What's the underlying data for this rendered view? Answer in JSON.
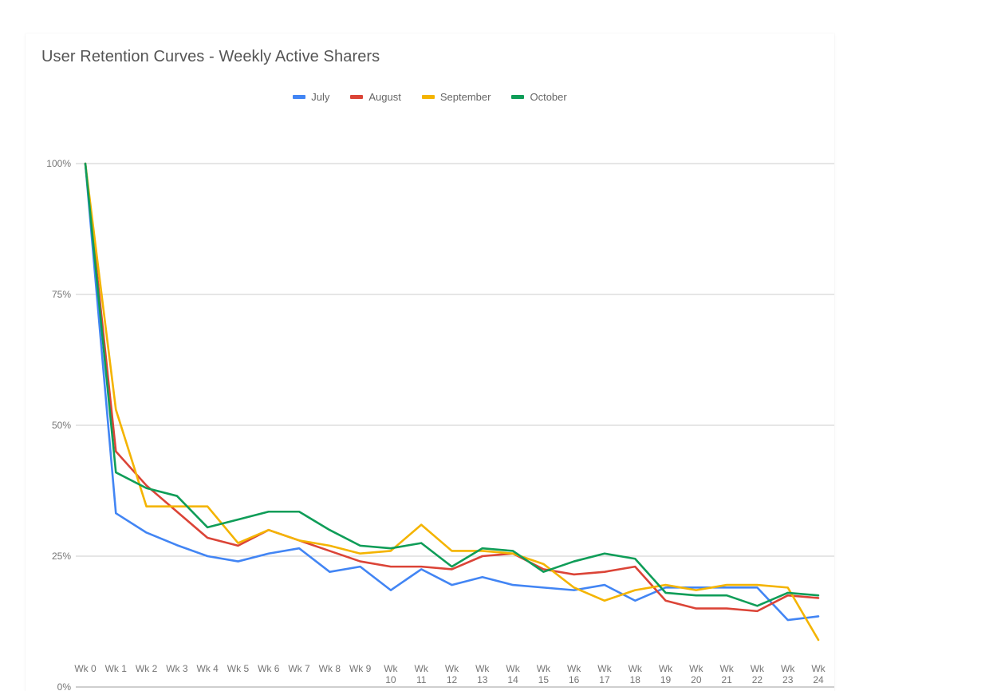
{
  "chart_title": "User Retention Curves - Weekly Active Sharers",
  "legend": {
    "position": "top-center",
    "entries": [
      {
        "label": "July",
        "color": "#4285F4"
      },
      {
        "label": "August",
        "color": "#DB4437"
      },
      {
        "label": "September",
        "color": "#F4B400"
      },
      {
        "label": "October",
        "color": "#0F9D58"
      }
    ]
  },
  "axes": {
    "y_ticks": [
      "0%",
      "25%",
      "50%",
      "75%",
      "100%"
    ],
    "x_ticks": [
      "Wk 0",
      "Wk 1",
      "Wk 2",
      "Wk 3",
      "Wk 4",
      "Wk 5",
      "Wk 6",
      "Wk 7",
      "Wk 8",
      "Wk 9",
      "Wk 10",
      "Wk 11",
      "Wk 12",
      "Wk 13",
      "Wk 14",
      "Wk 15",
      "Wk 16",
      "Wk 17",
      "Wk 18",
      "Wk 19",
      "Wk 20",
      "Wk 21",
      "Wk 22",
      "Wk 23",
      "Wk 24"
    ]
  },
  "chart_data": {
    "type": "line",
    "title": "User Retention Curves - Weekly Active Sharers",
    "xlabel": "",
    "ylabel": "",
    "ylim": [
      0,
      100
    ],
    "yticks": [
      0,
      25,
      50,
      75,
      100
    ],
    "ytick_labels": [
      "0%",
      "25%",
      "50%",
      "75%",
      "100%"
    ],
    "grid": "horizontal",
    "legend_position": "top-center",
    "categories": [
      "Wk 0",
      "Wk 1",
      "Wk 2",
      "Wk 3",
      "Wk 4",
      "Wk 5",
      "Wk 6",
      "Wk 7",
      "Wk 8",
      "Wk 9",
      "Wk 10",
      "Wk 11",
      "Wk 12",
      "Wk 13",
      "Wk 14",
      "Wk 15",
      "Wk 16",
      "Wk 17",
      "Wk 18",
      "Wk 19",
      "Wk 20",
      "Wk 21",
      "Wk 22",
      "Wk 23",
      "Wk 24"
    ],
    "series": [
      {
        "name": "July",
        "color": "#4285F4",
        "values": [
          100,
          33.2,
          29.5,
          27.1,
          25.0,
          24.0,
          25.5,
          26.5,
          22.0,
          23.0,
          18.5,
          22.5,
          19.5,
          21.0,
          19.5,
          19.0,
          18.5,
          19.5,
          16.5,
          19.0,
          19.0,
          19.0,
          19.0,
          12.8,
          13.5
        ]
      },
      {
        "name": "August",
        "color": "#DB4437",
        "values": [
          100,
          45.0,
          38.5,
          33.5,
          28.5,
          27.0,
          30.0,
          28.0,
          26.0,
          24.0,
          23.0,
          23.0,
          22.5,
          25.0,
          25.5,
          22.5,
          21.5,
          22.0,
          23.0,
          16.5,
          15.0,
          15.0,
          14.5,
          17.5,
          17.0
        ]
      },
      {
        "name": "September",
        "color": "#F4B400",
        "values": [
          100,
          53.0,
          34.5,
          34.5,
          34.5,
          27.5,
          30.0,
          28.0,
          27.0,
          25.5,
          26.0,
          31.0,
          26.0,
          26.0,
          25.5,
          23.5,
          19.0,
          16.5,
          18.5,
          19.5,
          18.5,
          19.5,
          19.5,
          19.0,
          9.0
        ]
      },
      {
        "name": "October",
        "color": "#0F9D58",
        "values": [
          100,
          41.0,
          38.0,
          36.5,
          30.5,
          32.0,
          33.5,
          33.5,
          30.0,
          27.0,
          26.5,
          27.5,
          23.0,
          26.5,
          26.0,
          22.0,
          24.0,
          25.5,
          24.5,
          18.0,
          17.5,
          17.5,
          15.5,
          18.0,
          17.5
        ]
      }
    ]
  },
  "plot_geometry": {
    "grid_color": "#cccccc",
    "axis_color": "#9e9e9e",
    "tick_color": "#757575"
  }
}
